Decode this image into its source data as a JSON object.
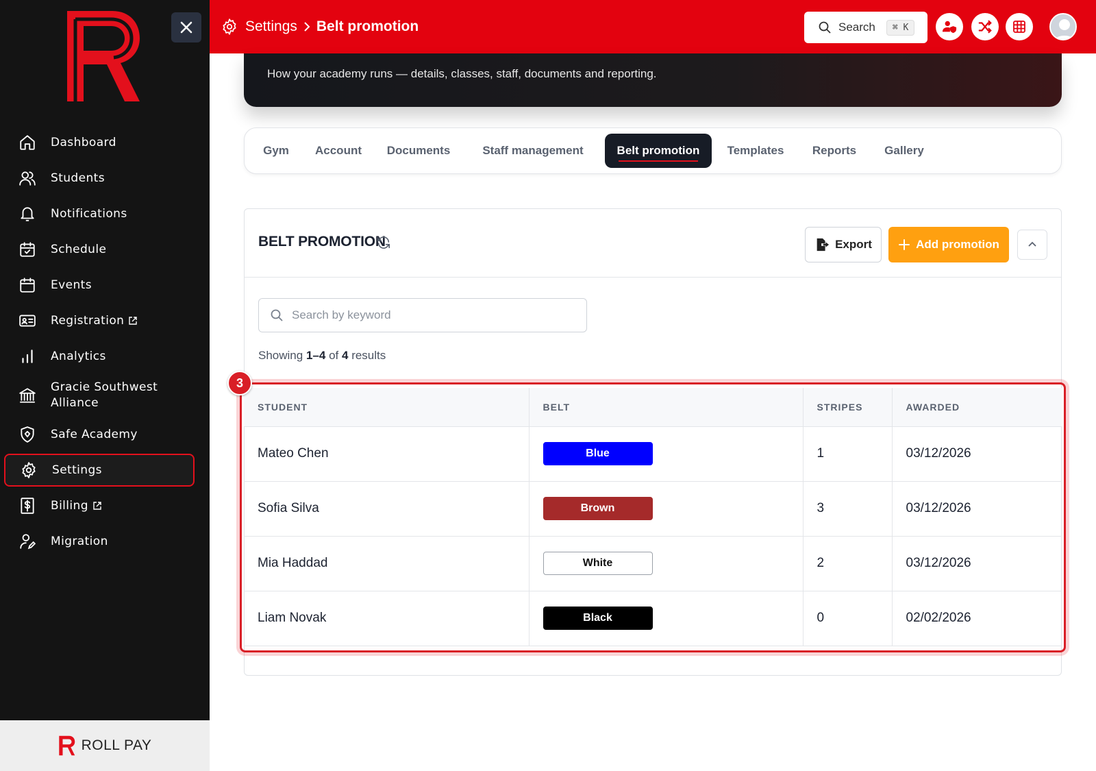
{
  "app": {
    "brand": "ROLL PAY",
    "logo_letter": "R"
  },
  "sidebar": {
    "items": [
      {
        "label": "Dashboard",
        "icon": "home-icon"
      },
      {
        "label": "Students",
        "icon": "users-icon"
      },
      {
        "label": "Notifications",
        "icon": "bell-icon"
      },
      {
        "label": "Schedule",
        "icon": "calendar-check-icon"
      },
      {
        "label": "Events",
        "icon": "calendar-icon"
      },
      {
        "label": "Registration",
        "icon": "id-card-icon",
        "external": true
      },
      {
        "label": "Analytics",
        "icon": "bar-chart-icon"
      },
      {
        "label": "Gracie Southwest Alliance",
        "icon": "bank-icon"
      },
      {
        "label": "Safe Academy",
        "icon": "shield-icon"
      },
      {
        "label": "Settings",
        "icon": "gear-icon",
        "active": true
      },
      {
        "label": "Billing",
        "icon": "dollar-doc-icon",
        "external": true
      },
      {
        "label": "Migration",
        "icon": "user-edit-icon"
      }
    ]
  },
  "topbar": {
    "breadcrumb_root": "Settings",
    "breadcrumb_current": "Belt promotion",
    "search_label": "Search",
    "search_shortcut": "⌘ K",
    "accent": "#e3020f"
  },
  "hero": {
    "subtitle": "How your academy runs — details, classes, staff, documents and reporting."
  },
  "tabs": [
    {
      "label": "Gym"
    },
    {
      "label": "Account"
    },
    {
      "label": "Documents"
    },
    {
      "label": "Staff management"
    },
    {
      "label": "Belt promotion",
      "active": true
    },
    {
      "label": "Templates"
    },
    {
      "label": "Reports"
    },
    {
      "label": "Gallery"
    }
  ],
  "panel": {
    "title": "BELT PROMOTION",
    "export_label": "Export",
    "add_label": "Add promotion",
    "search_placeholder": "Search by keyword",
    "results_prefix": "Showing",
    "results_range": "1–4",
    "results_of": "of",
    "results_total": "4",
    "results_suffix": "results",
    "highlight_badge": "3"
  },
  "table": {
    "headers": [
      "STUDENT",
      "BELT",
      "STRIPES",
      "AWARDED"
    ],
    "rows": [
      {
        "student": "Mateo Chen",
        "belt": "Blue",
        "belt_color": "#0000ff",
        "belt_text_color": "#ffffff",
        "stripes": "1",
        "awarded": "03/12/2026"
      },
      {
        "student": "Sofia Silva",
        "belt": "Brown",
        "belt_color": "#a52a2a",
        "belt_text_color": "#ffffff",
        "stripes": "3",
        "awarded": "03/12/2026"
      },
      {
        "student": "Mia Haddad",
        "belt": "White",
        "belt_color": "#ffffff",
        "belt_text_color": "#111111",
        "stripes": "2",
        "awarded": "03/12/2026"
      },
      {
        "student": "Liam Novak",
        "belt": "Black",
        "belt_color": "#000000",
        "belt_text_color": "#ffffff",
        "stripes": "0",
        "awarded": "02/02/2026"
      }
    ]
  }
}
